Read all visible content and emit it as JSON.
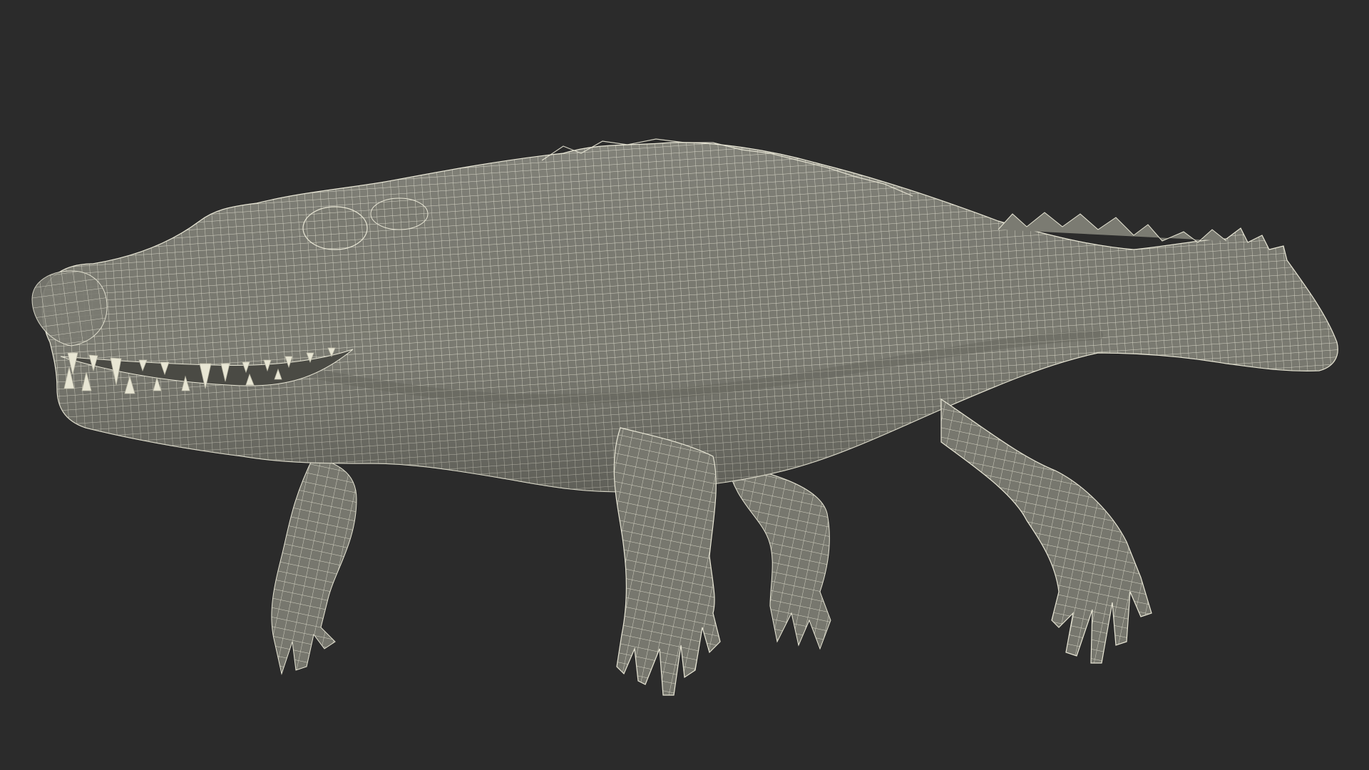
{
  "scene": {
    "subject_icon": "crocodile-wireframe-icon",
    "colors": {
      "background": "#2b2b2b",
      "mesh_fill": "#7b7b72",
      "mesh_shadow": "#5e5e57",
      "mesh_highlight": "#8a8a80",
      "wire": "#e9e7d6",
      "mouth_interior": "#4a4a44",
      "teeth": "#e8e6d4"
    }
  }
}
